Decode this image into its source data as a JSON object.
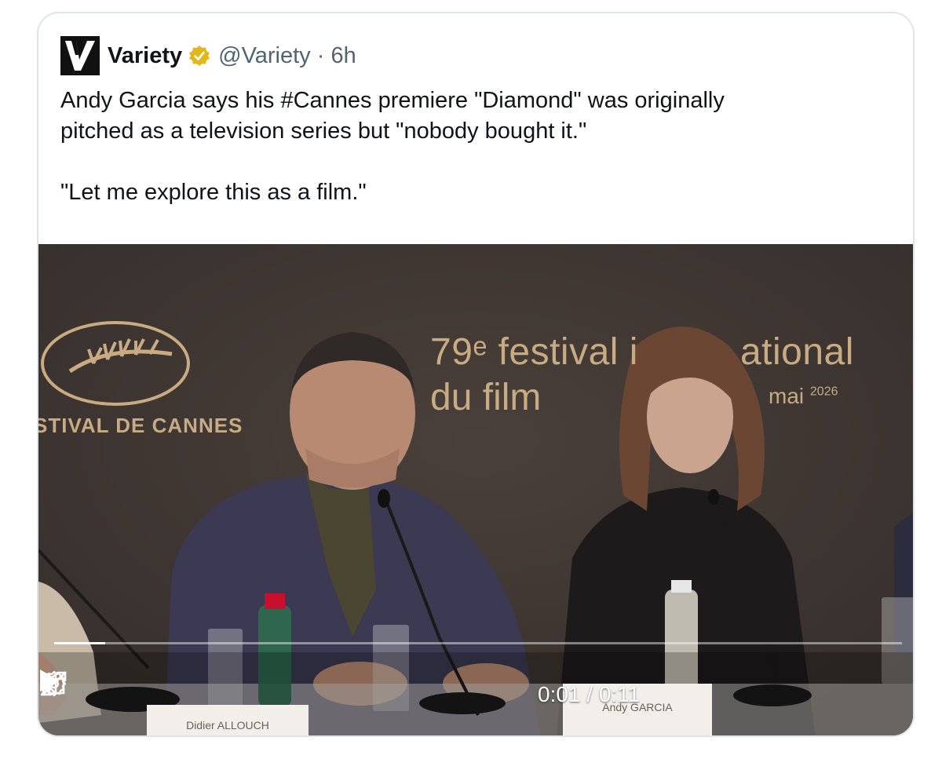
{
  "tweet": {
    "author_name": "Variety",
    "handle": "@Variety",
    "separator": "·",
    "time": "6h",
    "text_line1": "Andy Garcia says his #Cannes premiere \"Diamond\" was originally",
    "text_line2": "pitched as a television series but \"nobody bought it.\"",
    "text_line3": "\"Let me explore this as a film.\""
  },
  "video": {
    "festival_line1": "79ᵉ festival i",
    "festival_line1b": "ational",
    "festival_line2": "du film",
    "festival_date": "mai",
    "festival_year": "2026",
    "cannes_label": "STIVAL DE CANNES",
    "nameplate_left": "Didier ALLOUCH",
    "nameplate_center": "Andy GARCIA",
    "time_display": "0:01 / 0:11",
    "progress": 0.06
  },
  "colors": {
    "verified": "#e2b719",
    "handle_gray": "#536471",
    "festival_gold": "#c8ab82"
  },
  "icons": [
    "variety-logo",
    "verified-badge-icon",
    "play-icon",
    "mute-icon",
    "settings-gear-icon",
    "dock-icon",
    "fullscreen-icon"
  ]
}
